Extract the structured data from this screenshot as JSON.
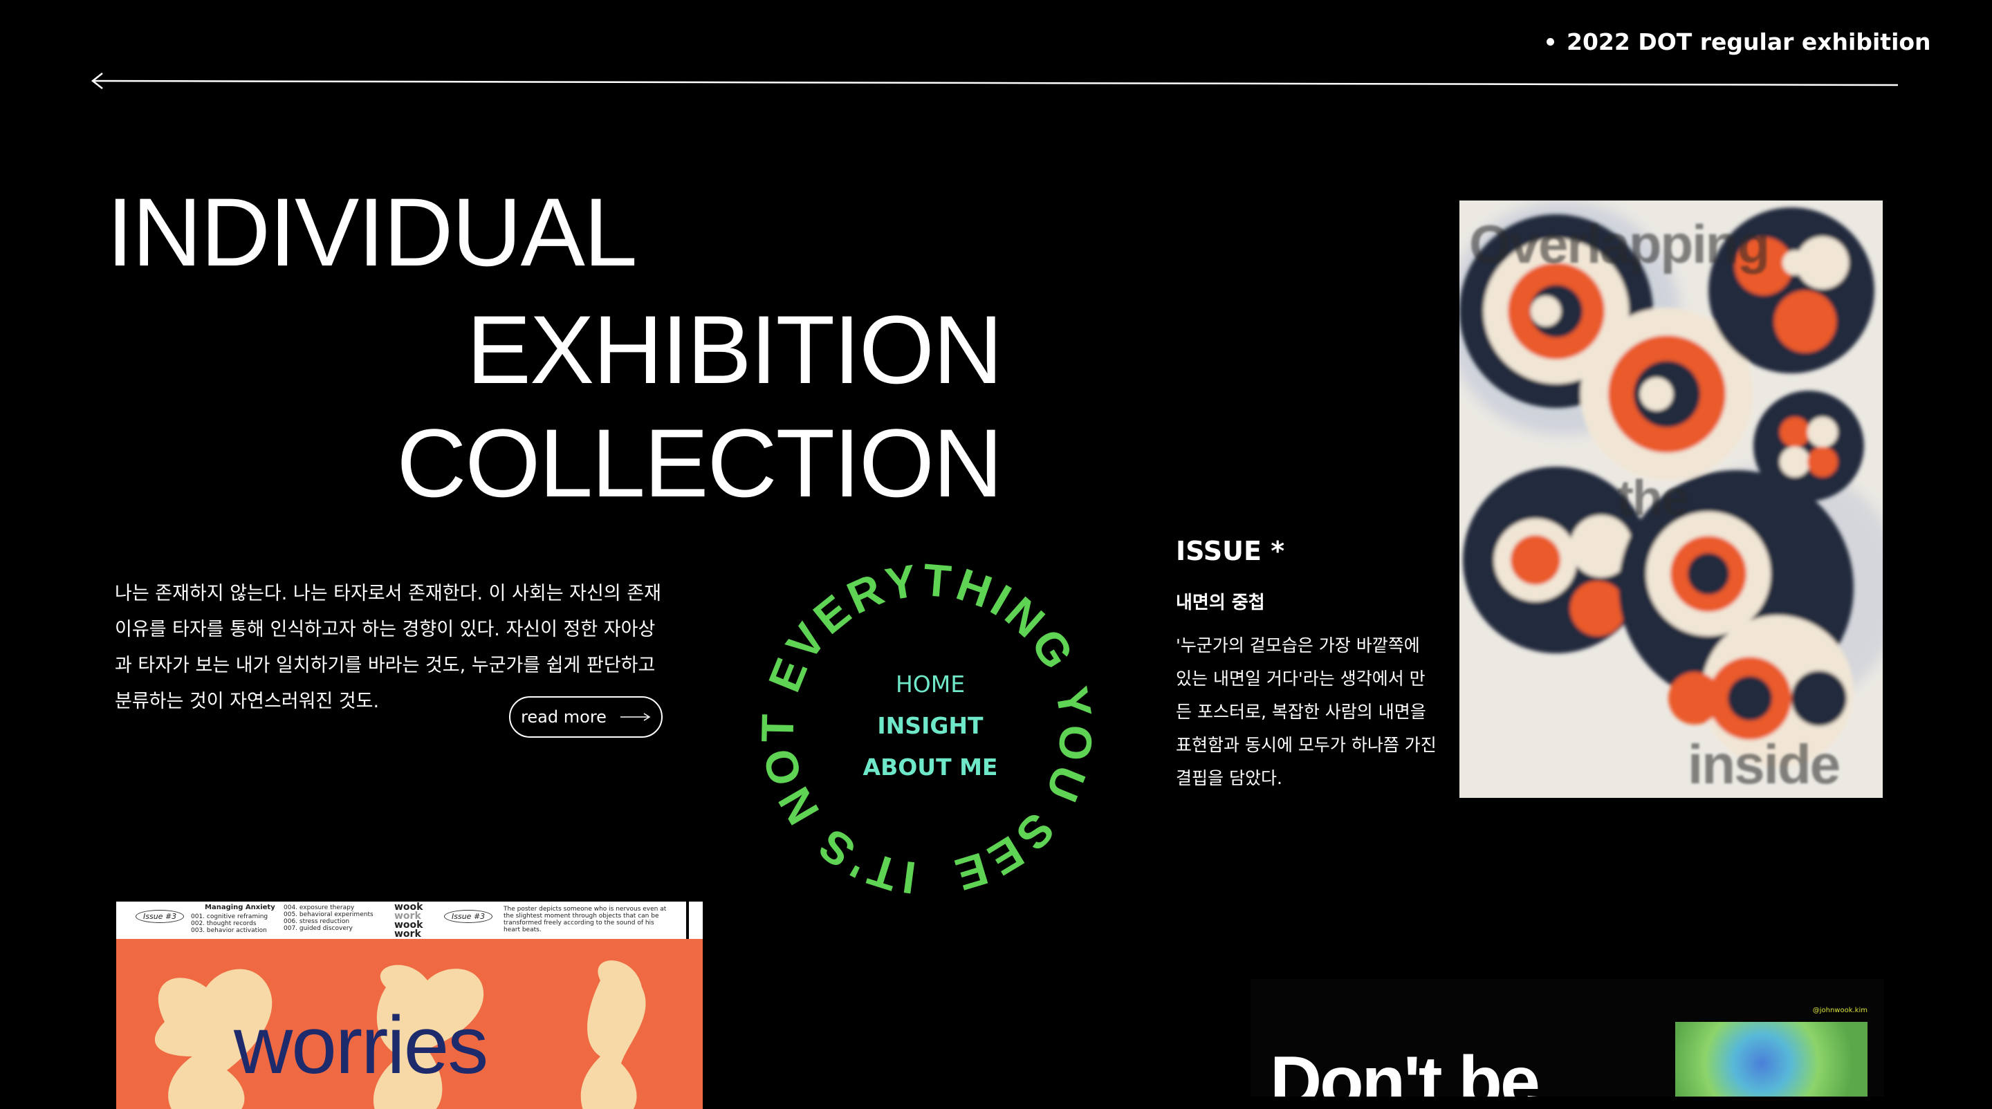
{
  "header": {
    "tag_label": "2022 DOT regular exhibition"
  },
  "title": {
    "line1": "INDIVIDUAL",
    "line2": "EXHIBITION",
    "line3": "COLLECTION"
  },
  "intro": {
    "text": "나는 존재하지 않는다. 나는 타자로서 존재한다. 이 사회는 자신의 존재 이유를 타자를 통해 인식하고자 하는 경향이 있다. 자신이 정한 자아상과 타자가 보는 내가 일치하기를 바라는 것도, 누군가를 쉽게 판단하고 분류하는 것이 자연스러워진 것도.",
    "read_more": "read more"
  },
  "circle_nav": {
    "ring_text": "IT'S NOT EVERYTHING YOU SEE",
    "ring_color": "#5fd454",
    "link_color": "#6ee8c8",
    "items": [
      "HOME",
      "INSIGHT",
      "ABOUT ME"
    ]
  },
  "issue": {
    "title": "ISSUE *",
    "subtitle": "내면의 중첩",
    "description": "'누군가의 겉모습은 가장 바깥쪽에 있는 내면일 거다'라는 생각에서 만든 포스터로, 복잡한 사람의 내면을 표현함과 동시에 모두가 하나쯤 가진 결핍을 담았다."
  },
  "poster_right": {
    "top_text": "Overlapping",
    "mid_text": "the",
    "bottom_text": "inside",
    "colors": {
      "orange": "#ea5a2c",
      "navy": "#222a3c",
      "cream": "#f1e6d6"
    }
  },
  "poster_left": {
    "issue_label_1": "Issue #3",
    "issue_label_2": "Issue #3",
    "heading": "Managing Anxiety",
    "list_a": [
      "001. cognitive reframing",
      "002. thought records",
      "003. behavior activation"
    ],
    "list_b": [
      "004. exposure therapy",
      "005. behavioral experiments",
      "006. stress reduction",
      "007. guided discovery"
    ],
    "wook_words": [
      "wook",
      "work",
      "wook",
      "work"
    ],
    "side_text": "The poster depicts someone who is nervous even at the slightest moment through objects that can be transformed freely according to the sound of his heart beats.",
    "word": "worries"
  },
  "poster_bottom_right": {
    "headline": "Don't be",
    "handle": "@johnwook.kim"
  }
}
